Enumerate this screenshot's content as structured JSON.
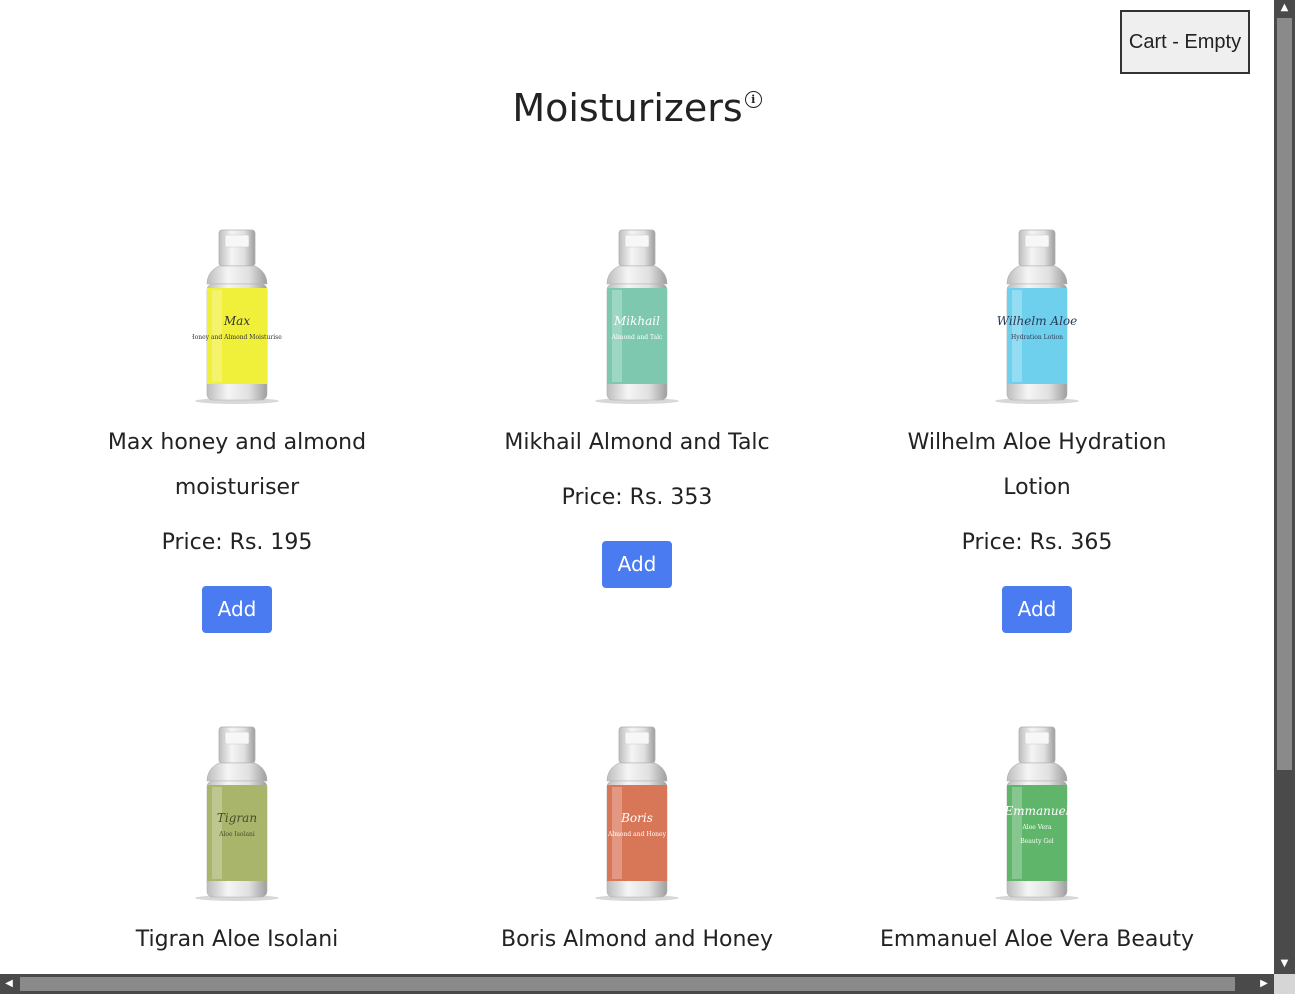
{
  "cart": {
    "label": "Cart - Empty"
  },
  "page": {
    "title": "Moisturizers",
    "info_icon": "info-icon"
  },
  "products": [
    {
      "name": "Max honey and almond moisturiser",
      "price": "Price: Rs. 195",
      "add": "Add",
      "label_lines": [
        "Max",
        "Honey and Almond Moisturiser"
      ],
      "color": "#f0ef3a",
      "label_color": "#333333"
    },
    {
      "name": "Mikhail Almond and Talc",
      "price": "Price: Rs. 353",
      "add": "Add",
      "label_lines": [
        "Mikhail",
        "Almond and Talc"
      ],
      "color": "#7ec8b0",
      "label_color": "#ffffff"
    },
    {
      "name": "Wilhelm Aloe Hydration Lotion",
      "price": "Price: Rs. 365",
      "add": "Add",
      "label_lines": [
        "Wilhelm Aloe",
        "Hydration Lotion"
      ],
      "color": "#6fd0ee",
      "label_color": "#2a3a55"
    },
    {
      "name": "Tigran Aloe Isolani",
      "price": "",
      "add": "",
      "label_lines": [
        "Tigran",
        "Aloe Isolani"
      ],
      "color": "#aab56c",
      "label_color": "#4a4a2a"
    },
    {
      "name": "Boris Almond and Honey",
      "price": "",
      "add": "",
      "label_lines": [
        "Boris",
        "Almond and Honey"
      ],
      "color": "#d87658",
      "label_color": "#ffffff"
    },
    {
      "name": "Emmanuel Aloe Vera Beauty Gel",
      "price": "",
      "add": "",
      "label_lines": [
        "Emmanuel",
        "Aloe Vera",
        "Beauty Gel"
      ],
      "color": "#5fb56a",
      "label_color": "#ffffff"
    }
  ]
}
